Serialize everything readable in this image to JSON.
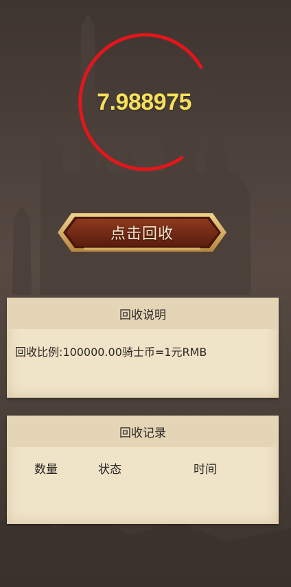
{
  "balance": {
    "value": "7.988975"
  },
  "claim_button": {
    "label": "点击回收"
  },
  "info_panel": {
    "title": "回收说明",
    "text": "回收比例:100000.00骑士币=1元RMB"
  },
  "records_panel": {
    "title": "回收记录",
    "columns": [
      "数量",
      "状态",
      "时间"
    ]
  },
  "colors": {
    "ring": "#e3161b",
    "balance_text": "#f6e05a",
    "button_fill": "#7a2c16",
    "button_frame": "#d9b06a",
    "panel": "#efe3c8",
    "panel_header": "#e4d5b7"
  }
}
